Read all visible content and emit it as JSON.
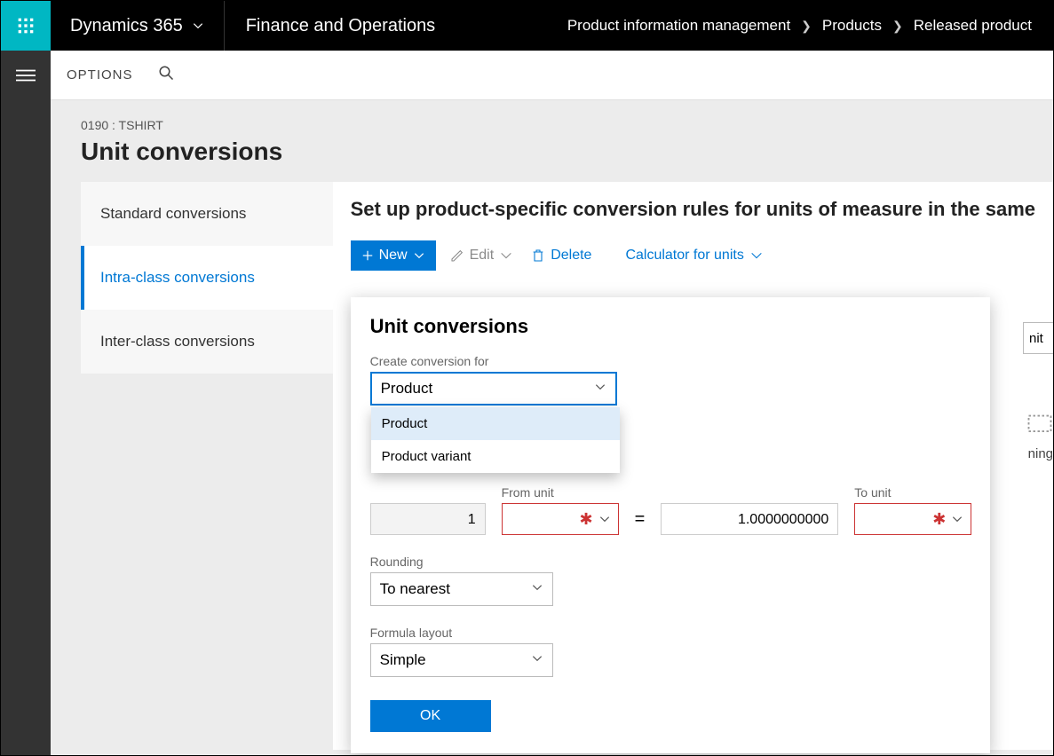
{
  "topbar": {
    "brand": "Dynamics 365",
    "module": "Finance and Operations",
    "breadcrumbs": [
      "Product information management",
      "Products",
      "Released product"
    ]
  },
  "subbar": {
    "options": "OPTIONS"
  },
  "page": {
    "context": "0190 : TSHIRT",
    "title": "Unit conversions"
  },
  "tabs": {
    "items": [
      "Standard conversions",
      "Intra-class conversions",
      "Inter-class conversions"
    ],
    "active_index": 1
  },
  "rightpanel": {
    "heading": "Set up product-specific conversion rules for units of measure in the same"
  },
  "toolbar": {
    "new": "New",
    "edit": "Edit",
    "delete": "Delete",
    "calc": "Calculator for units"
  },
  "flyout": {
    "title": "Unit conversions",
    "create_for_label": "Create conversion for",
    "create_for_value": "Product",
    "options": [
      "Product",
      "Product variant"
    ],
    "from_unit_label": "From unit",
    "to_unit_label": "To unit",
    "factor_left": "1",
    "factor_right": "1.0000000000",
    "rounding_label": "Rounding",
    "rounding_value": "To nearest",
    "formula_label": "Formula layout",
    "formula_value": "Simple",
    "ok": "OK"
  },
  "cut": {
    "unit": "nit",
    "text": "ning"
  }
}
